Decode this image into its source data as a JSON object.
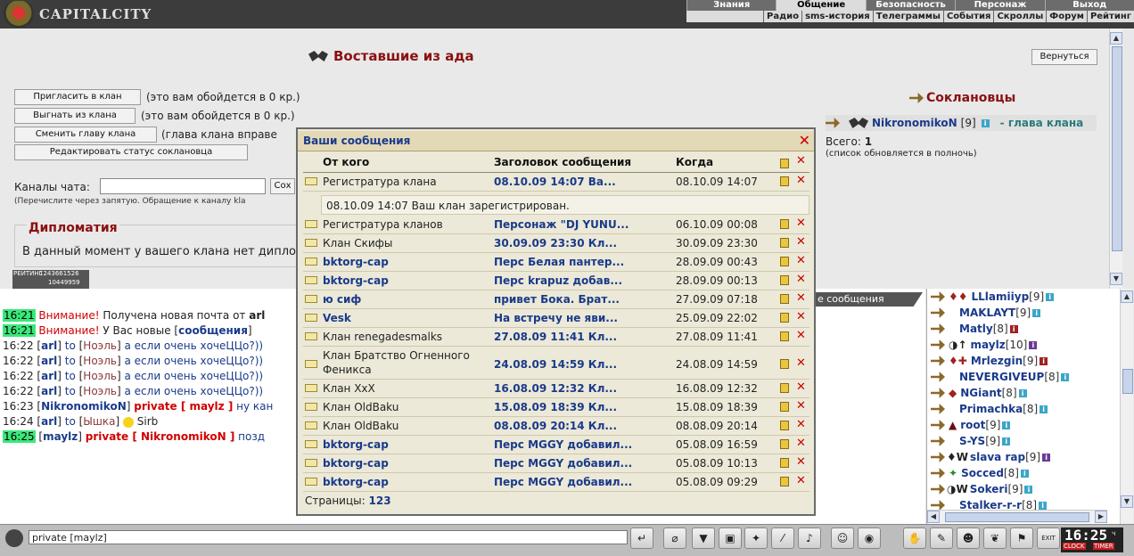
{
  "app": {
    "title": "CAPITALCITY"
  },
  "menu_top": [
    "Знания",
    "Общение",
    "Безопасность",
    "Персонаж",
    "Выход"
  ],
  "menu_sub": [
    "Радио",
    "sms-история",
    "Телеграммы",
    "События",
    "Скроллы",
    "Форум",
    "Рейтинг"
  ],
  "clan": {
    "name": "Воставшие из ада",
    "back_button": "Вернуться",
    "invite_button": "Пригласить в клан",
    "invite_cost": "(это вам обойдется в 0 кр.)",
    "kick_button": "Выгнать из клана",
    "kick_cost": "(это вам обойдется в 0 кр.)",
    "change_head_button": "Сменить главу клана",
    "change_head_note": "(глава клана вправе",
    "edit_status_button": "Редактировать статус соклановца",
    "chat_channels_label": "Каналы чата:",
    "chat_channels_btn": "Сох",
    "chat_channels_hint": "(Перечислите через запятую. Обращение к каналу kla",
    "diplomacy_title": "Дипломатия",
    "diplomacy_text": "В данный момент у вашего клана нет дипло",
    "members_title": "Соклановцы",
    "head_name": "NikronomikoN",
    "head_level": "[9]",
    "head_role": "- глава клана",
    "total_label": "Всего:",
    "total_value": "1",
    "list_note": "(список обновляется в полночь)",
    "rating_counter_1": "РЕЙТИНГ",
    "rating_counter_2": "1243661526",
    "rating_counter_3": "10449959"
  },
  "tab_partial": "е сообщения",
  "dialog": {
    "title": "Ваши сообщения",
    "col_from": "От кого",
    "col_subject": "Заголовок сообщения",
    "col_when": "Когда",
    "expanded_text": "08.10.09 14:07 Ваш клан зарегистрирован.",
    "pages_label": "Страницы:",
    "pages_value": "123",
    "messages": [
      {
        "from": "Регистратура клана",
        "subject": "08.10.09 14:07 Ва...",
        "when": "08.10.09 14:07",
        "bold": false
      },
      {
        "from": "Регистратура кланов",
        "subject": "Персонаж \"DJ YUNU...",
        "when": "06.10.09 00:08",
        "bold": false
      },
      {
        "from": "Клан Скифы",
        "subject": "30.09.09 23:30 Кл...",
        "when": "30.09.09 23:30",
        "bold": false
      },
      {
        "from": "bktorg-cap",
        "subject": "Перс Белая пантер...",
        "when": "28.09.09 00:43",
        "bold": true
      },
      {
        "from": "bktorg-cap",
        "subject": "Перс krapuz добав...",
        "when": "28.09.09 00:13",
        "bold": true
      },
      {
        "from": "ю сиф",
        "subject": "привет Бока. Брат...",
        "when": "27.09.09 07:18",
        "bold": true
      },
      {
        "from": "Vesk",
        "subject": "На встречу не яви...",
        "when": "25.09.09 22:02",
        "bold": true
      },
      {
        "from": "Клан renegadesmalks",
        "subject": "27.08.09 11:41 Кл...",
        "when": "27.08.09 11:41",
        "bold": false
      },
      {
        "from": "Клан Братство Огненного",
        "from2": "Феникса",
        "subject": "24.08.09 14:59 Кл...",
        "when": "24.08.09 14:59",
        "bold": false
      },
      {
        "from": "Клан XxX",
        "subject": "16.08.09 12:32 Кл...",
        "when": "16.08.09 12:32",
        "bold": false
      },
      {
        "from": "Клан OldBaku",
        "subject": "15.08.09 18:39 Кл...",
        "when": "15.08.09 18:39",
        "bold": false
      },
      {
        "from": "Клан OldBaku",
        "subject": "08.08.09 20:14 Кл...",
        "when": "08.08.09 20:14",
        "bold": false
      },
      {
        "from": "bktorg-cap",
        "subject": "Перс MGGY добавил...",
        "when": "05.08.09 16:59",
        "bold": true
      },
      {
        "from": "bktorg-cap",
        "subject": "Перс MGGY добавил...",
        "when": "05.08.09 10:13",
        "bold": true
      },
      {
        "from": "bktorg-cap",
        "subject": "Перс MGGY добавил...",
        "when": "05.08.09 09:29",
        "bold": true
      }
    ]
  },
  "chat": {
    "lines": [
      {
        "time": "16:21",
        "a": "Внимание!",
        "b": " Получена новая почта от ",
        "c": "arl"
      },
      {
        "time": "16:21",
        "a": "Внимание!",
        "b": " У Вас новые [",
        "c": "сообщения",
        "d": "]"
      },
      {
        "time": "16:22",
        "nick": "arl",
        "to": "Ноэль",
        "text": " а если очень хочеЦЦо?))"
      },
      {
        "time": "16:22",
        "nick": "arl",
        "to": "Ноэль",
        "text": " а если очень хочеЦЦо?))"
      },
      {
        "time": "16:22",
        "nick": "arl",
        "to": "Ноэль",
        "text": " а если очень хочеЦЦо?))"
      },
      {
        "time": "16:22",
        "nick": "arl",
        "to": "Ноэль",
        "text": " а если очень хочеЦЦо?))"
      },
      {
        "time": "16:23",
        "nick": "NikronomikoN",
        "priv": "private [ maylz ]",
        "text": " ну кан"
      },
      {
        "time": "16:24",
        "nick": "arl",
        "to": "Ышка",
        "text": "  Sirb"
      },
      {
        "time": "16:25",
        "nick": "maylz",
        "priv": "private [ NikronomikoN ]",
        "text": " позд"
      }
    ],
    "to_word": " to ",
    "input_value": "private [maylz]"
  },
  "users": [
    {
      "name": "LLlamiiyp",
      "level": "[9]"
    },
    {
      "name": "MAKLAYT",
      "level": "[9]"
    },
    {
      "name": "Matly",
      "level": "[8]"
    },
    {
      "name": "maylz",
      "level": "[10]"
    },
    {
      "name": "Mrlezgin",
      "level": "[9]"
    },
    {
      "name": "NEVERGIVEUP",
      "level": "[8]"
    },
    {
      "name": "NGiant",
      "level": "[8]"
    },
    {
      "name": "Primachka",
      "level": "[8]"
    },
    {
      "name": "root",
      "level": "[9]"
    },
    {
      "name": "S-YS",
      "level": "[9]"
    },
    {
      "name": "slava rap",
      "level": "[9]"
    },
    {
      "name": "Socced",
      "level": "[8]"
    },
    {
      "name": "Sokeri",
      "level": "[9]"
    },
    {
      "name": "Stalker-r-r",
      "level": "[8]"
    }
  ],
  "clock": {
    "time": "16:25",
    "unit": "ч",
    "clock_label": "CLOCK",
    "timer_label": "TIMER"
  },
  "bottom_exit": "EXIT",
  "colors": {
    "accent_red": "#8a1010",
    "nick_blue": "#1a3a8a",
    "time_green": "#3ae87a"
  }
}
